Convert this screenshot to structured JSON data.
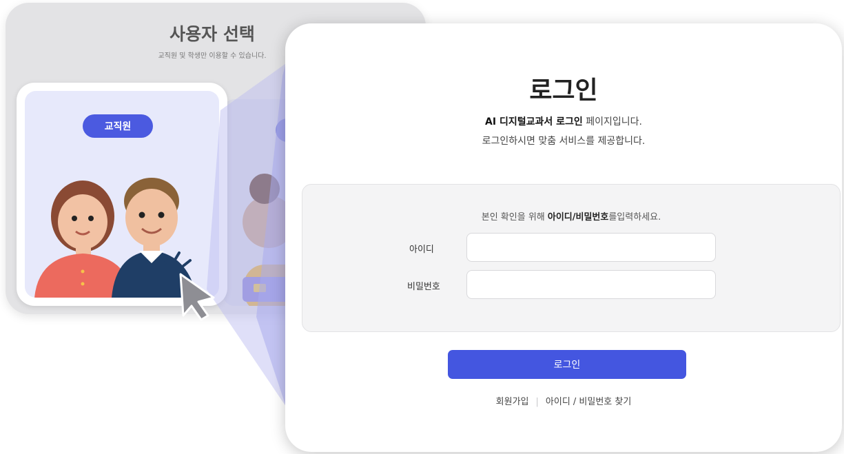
{
  "select_panel": {
    "title": "사용자 선택",
    "subtitle": "교직원 및 학생만 이용할 수 있습니다.",
    "card_primary": {
      "role_label": "교직원"
    }
  },
  "login": {
    "title": "로그인",
    "description_bold": "AI 디지털교과서 로그인",
    "description_rest": " 페이지입니다.",
    "description_line2": "로그인하시면 맞춤 서비스를 제공합니다.",
    "instruction_prefix": "본인 확인을 위해 ",
    "instruction_bold": "아이디/비밀번호",
    "instruction_suffix": "를입력하세요.",
    "id_label": "아이디",
    "id_value": "",
    "password_label": "비밀번호",
    "password_value": "",
    "login_button": "로그인",
    "signup_link": "회원가입",
    "separator": "|",
    "find_link": "아이디 / 비밀번호 찾기"
  },
  "colors": {
    "accent": "#4456e0",
    "pill": "#4b5ae0",
    "card_background": "#e7e9fb",
    "panel_background": "#e3e3e5"
  },
  "icons": [
    "teacher-woman-illustration",
    "teacher-man-illustration",
    "student-illustration",
    "click-cursor-icon"
  ]
}
